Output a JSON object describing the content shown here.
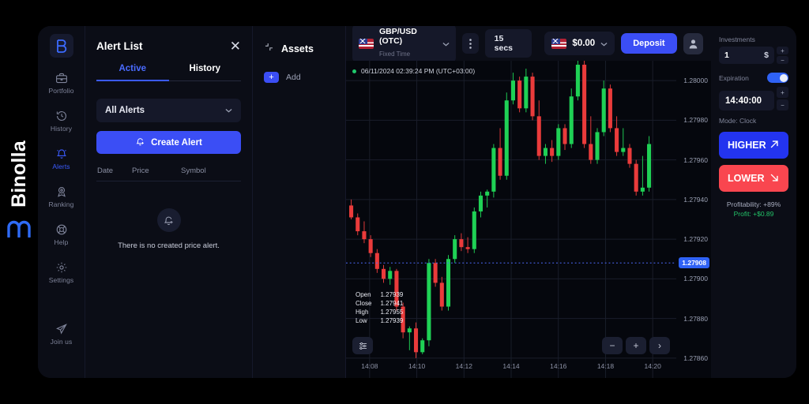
{
  "brand": {
    "name": "Binolla",
    "mark": "m-logo-icon"
  },
  "rail": {
    "logo": "binolla-b-logo",
    "items": [
      {
        "label": "Portfolio",
        "icon": "briefcase-icon",
        "active": false
      },
      {
        "label": "History",
        "icon": "clock-history-icon",
        "active": false
      },
      {
        "label": "Alerts",
        "icon": "bell-icon",
        "active": true
      },
      {
        "label": "Ranking",
        "icon": "trophy-icon",
        "active": false
      },
      {
        "label": "Help",
        "icon": "lifebuoy-icon",
        "active": false
      },
      {
        "label": "Settings",
        "icon": "gear-icon",
        "active": false
      },
      {
        "label": "Join us",
        "icon": "telegram-send-icon",
        "active": false
      }
    ]
  },
  "alert_panel": {
    "title": "Alert List",
    "close_icon": "close-icon",
    "tabs": [
      {
        "label": "Active",
        "active": true
      },
      {
        "label": "History",
        "active": false
      }
    ],
    "filter": {
      "value": "All Alerts",
      "chevron": "chevron-down-icon"
    },
    "create_button": {
      "label": "Create Alert",
      "icon": "bell-plus-icon"
    },
    "columns": [
      "Date",
      "Price",
      "Symbol"
    ],
    "empty": {
      "icon": "bell-plus-icon",
      "text": "There is no created price alert."
    }
  },
  "assets_panel": {
    "title": "Assets",
    "title_icon": "collapse-arrows-icon",
    "add": {
      "label": "Add",
      "icon": "plus-icon"
    }
  },
  "chart_header": {
    "symbol": {
      "name": "GBP/USD (OTC)",
      "subtitle": "Fixed Time",
      "flag": "gb-us-flag-icon",
      "chevron": "chevron-down-icon"
    },
    "menu_icon": "more-vertical-icon",
    "timeframe": "15 secs",
    "balance": {
      "amount": "$0.00",
      "flag": "us-flag-icon",
      "chevron": "chevron-down-icon"
    },
    "deposit_label": "Deposit",
    "avatar_icon": "user-avatar-icon"
  },
  "chart": {
    "timestamp": "06/11/2024 02:39:24 PM  (UTC+03:00)",
    "ohlc": [
      {
        "key": "Open",
        "value": "1.27939"
      },
      {
        "key": "Close",
        "value": "1.27941"
      },
      {
        "key": "High",
        "value": "1.27955"
      },
      {
        "key": "Low",
        "value": "1.27939"
      }
    ],
    "controls": {
      "settings_icon": "chart-settings-icon",
      "zoom_out": "−",
      "zoom_in": "+",
      "next": "›"
    },
    "current_price": "1.27908"
  },
  "trade": {
    "investments_label": "Investments",
    "investment_value": "1",
    "currency": "$",
    "step_up": "+",
    "step_down": "−",
    "expiration_label": "Expiration",
    "expiration_value": "14:40:00",
    "mode_label": "Mode: Clock",
    "higher": {
      "label": "HIGHER",
      "icon": "arrow-up-right-icon"
    },
    "lower": {
      "label": "LOWER",
      "icon": "arrow-down-right-icon"
    },
    "profitability": "Profitability: +89%",
    "profit": "Profit: +$0.89"
  },
  "chart_data": {
    "type": "candlestick",
    "title": "GBP/USD (OTC) 15 secs",
    "xlabel": "",
    "ylabel": "",
    "ylim": [
      1.2785,
      1.2801
    ],
    "y_ticks": [
      "1.28000",
      "1.27980",
      "1.27960",
      "1.27940",
      "1.27920",
      "1.27900",
      "1.27880",
      "1.27860"
    ],
    "x_ticks": [
      "14:08",
      "14:10",
      "14:12",
      "14:14",
      "14:16",
      "14:18",
      "14:20"
    ],
    "grid": true,
    "current_price_line": 1.27908,
    "up_color": "#1fd155",
    "down_color": "#ea3b3b",
    "candles": [
      {
        "o": 1.27937,
        "h": 1.2794,
        "l": 1.2793,
        "c": 1.27931
      },
      {
        "o": 1.27931,
        "h": 1.27933,
        "l": 1.27922,
        "c": 1.27924
      },
      {
        "o": 1.27924,
        "h": 1.27929,
        "l": 1.27918,
        "c": 1.2792
      },
      {
        "o": 1.2792,
        "h": 1.27922,
        "l": 1.27911,
        "c": 1.27913
      },
      {
        "o": 1.27913,
        "h": 1.27915,
        "l": 1.27903,
        "c": 1.27905
      },
      {
        "o": 1.27905,
        "h": 1.27907,
        "l": 1.27898,
        "c": 1.279
      },
      {
        "o": 1.279,
        "h": 1.27906,
        "l": 1.27897,
        "c": 1.27904
      },
      {
        "o": 1.27904,
        "h": 1.27905,
        "l": 1.27884,
        "c": 1.27886
      },
      {
        "o": 1.27886,
        "h": 1.27888,
        "l": 1.2787,
        "c": 1.27873
      },
      {
        "o": 1.27873,
        "h": 1.27876,
        "l": 1.27864,
        "c": 1.27875
      },
      {
        "o": 1.27875,
        "h": 1.27878,
        "l": 1.2786,
        "c": 1.27863
      },
      {
        "o": 1.27863,
        "h": 1.2787,
        "l": 1.27862,
        "c": 1.27869
      },
      {
        "o": 1.27869,
        "h": 1.2791,
        "l": 1.27866,
        "c": 1.27908
      },
      {
        "o": 1.27908,
        "h": 1.2791,
        "l": 1.27896,
        "c": 1.27898
      },
      {
        "o": 1.27898,
        "h": 1.27901,
        "l": 1.27884,
        "c": 1.27886
      },
      {
        "o": 1.27886,
        "h": 1.27912,
        "l": 1.27884,
        "c": 1.2791
      },
      {
        "o": 1.2791,
        "h": 1.27922,
        "l": 1.27908,
        "c": 1.2792
      },
      {
        "o": 1.2792,
        "h": 1.27923,
        "l": 1.27914,
        "c": 1.27916
      },
      {
        "o": 1.27916,
        "h": 1.27921,
        "l": 1.27913,
        "c": 1.27915
      },
      {
        "o": 1.27915,
        "h": 1.27936,
        "l": 1.27913,
        "c": 1.27934
      },
      {
        "o": 1.27934,
        "h": 1.27944,
        "l": 1.27931,
        "c": 1.27942
      },
      {
        "o": 1.27942,
        "h": 1.27945,
        "l": 1.27936,
        "c": 1.27944
      },
      {
        "o": 1.27944,
        "h": 1.27968,
        "l": 1.27941,
        "c": 1.27966
      },
      {
        "o": 1.27966,
        "h": 1.27976,
        "l": 1.2795,
        "c": 1.27952
      },
      {
        "o": 1.27952,
        "h": 1.27994,
        "l": 1.2795,
        "c": 1.2799
      },
      {
        "o": 1.2799,
        "h": 1.28004,
        "l": 1.27988,
        "c": 1.28
      },
      {
        "o": 1.28,
        "h": 1.28002,
        "l": 1.27984,
        "c": 1.27986
      },
      {
        "o": 1.27986,
        "h": 1.28006,
        "l": 1.27984,
        "c": 1.28002
      },
      {
        "o": 1.28002,
        "h": 1.28004,
        "l": 1.2798,
        "c": 1.27982
      },
      {
        "o": 1.27982,
        "h": 1.2799,
        "l": 1.2796,
        "c": 1.27962
      },
      {
        "o": 1.27962,
        "h": 1.27968,
        "l": 1.27958,
        "c": 1.27966
      },
      {
        "o": 1.27966,
        "h": 1.2797,
        "l": 1.27959,
        "c": 1.27962
      },
      {
        "o": 1.27962,
        "h": 1.27978,
        "l": 1.2796,
        "c": 1.27976
      },
      {
        "o": 1.27976,
        "h": 1.27978,
        "l": 1.27965,
        "c": 1.27968
      },
      {
        "o": 1.27968,
        "h": 1.27996,
        "l": 1.27966,
        "c": 1.27992
      },
      {
        "o": 1.27992,
        "h": 1.28012,
        "l": 1.2799,
        "c": 1.28008
      },
      {
        "o": 1.28008,
        "h": 1.2801,
        "l": 1.27966,
        "c": 1.27968
      },
      {
        "o": 1.27968,
        "h": 1.27982,
        "l": 1.27958,
        "c": 1.2796
      },
      {
        "o": 1.2796,
        "h": 1.27976,
        "l": 1.27958,
        "c": 1.27974
      },
      {
        "o": 1.27974,
        "h": 1.28,
        "l": 1.27972,
        "c": 1.27996
      },
      {
        "o": 1.27996,
        "h": 1.27998,
        "l": 1.27974,
        "c": 1.27976
      },
      {
        "o": 1.27976,
        "h": 1.27982,
        "l": 1.27962,
        "c": 1.27964
      },
      {
        "o": 1.27964,
        "h": 1.27976,
        "l": 1.27962,
        "c": 1.27966
      },
      {
        "o": 1.27966,
        "h": 1.27968,
        "l": 1.27956,
        "c": 1.27958
      },
      {
        "o": 1.27958,
        "h": 1.2796,
        "l": 1.27942,
        "c": 1.27944
      },
      {
        "o": 1.27944,
        "h": 1.27962,
        "l": 1.27942,
        "c": 1.27946
      },
      {
        "o": 1.27946,
        "h": 1.27972,
        "l": 1.27944,
        "c": 1.27968
      }
    ]
  },
  "annotation": {
    "type": "arrow",
    "color": "#ee1111",
    "points": "from sidebar Alerts item to lower-right"
  }
}
